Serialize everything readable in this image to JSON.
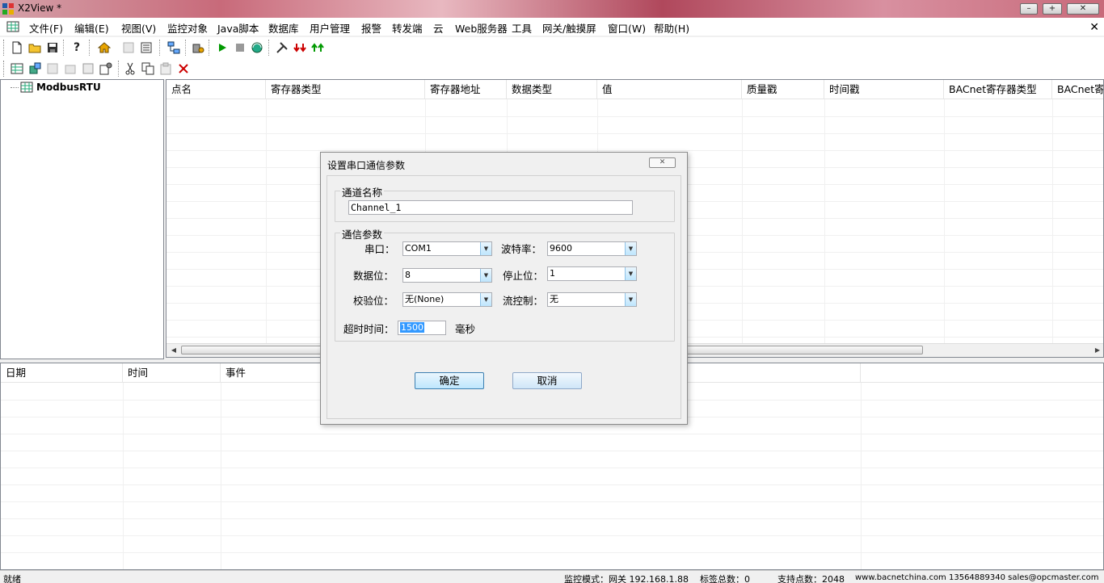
{
  "window": {
    "title": "X2View *",
    "controls": {
      "minimize": "–",
      "maximize": "+",
      "close": "✕"
    }
  },
  "menu": {
    "items": [
      {
        "label": "文件(F)",
        "small": false
      },
      {
        "label": "编辑(E)",
        "small": false
      },
      {
        "label": "视图(V)",
        "small": false
      },
      {
        "label": "监控对象",
        "small": false
      },
      {
        "label": "Java脚本",
        "small": false
      },
      {
        "label": "数据库",
        "small": false
      },
      {
        "label": "用户管理",
        "small": false
      },
      {
        "label": "报警",
        "small": false
      },
      {
        "label": "转发端",
        "small": false
      },
      {
        "label": "云",
        "small": false
      },
      {
        "label": "Web服务器",
        "small": false
      },
      {
        "label": "工具",
        "small": false
      },
      {
        "label": "网关/触摸屏",
        "small": false
      },
      {
        "label": "窗口(W)",
        "small": false
      },
      {
        "label": "帮助(H)",
        "small": false
      }
    ],
    "close_glyph": "✕"
  },
  "tree": {
    "root_label": "ModbusRTU"
  },
  "grid": {
    "columns": [
      "点名",
      "寄存器类型",
      "寄存器地址",
      "数据类型",
      "值",
      "质量戳",
      "时间戳",
      "BACnet寄存器类型",
      "BACnet寄存"
    ]
  },
  "log": {
    "columns": [
      "日期",
      "时间",
      "事件"
    ]
  },
  "statusbar": {
    "ready": "就绪",
    "mode": "监控模式：网关 192.168.1.88",
    "tag_total": "标签总数：0",
    "support_points": "支持点数：2048",
    "contact": "www.bacnetchina.com 13564889340 sales@opcmaster.com"
  },
  "dialog": {
    "title": "设置串口通信参数",
    "close_glyph": "✕",
    "channel_group": "通道名称",
    "channel_name": "Channel_1",
    "comm_group": "通信参数",
    "port_label": "串口：",
    "port_value": "COM1",
    "baud_label": "波特率：",
    "baud_value": "9600",
    "databits_label": "数据位：",
    "databits_value": "8",
    "stopbits_label": "停止位：",
    "stopbits_value": "1",
    "parity_label": "校验位：",
    "parity_value": "无(None)",
    "flow_label": "流控制：",
    "flow_value": "无",
    "timeout_label": "超时时间：",
    "timeout_value": "1500",
    "timeout_unit": "毫秒",
    "ok_label": "确定",
    "cancel_label": "取消"
  }
}
